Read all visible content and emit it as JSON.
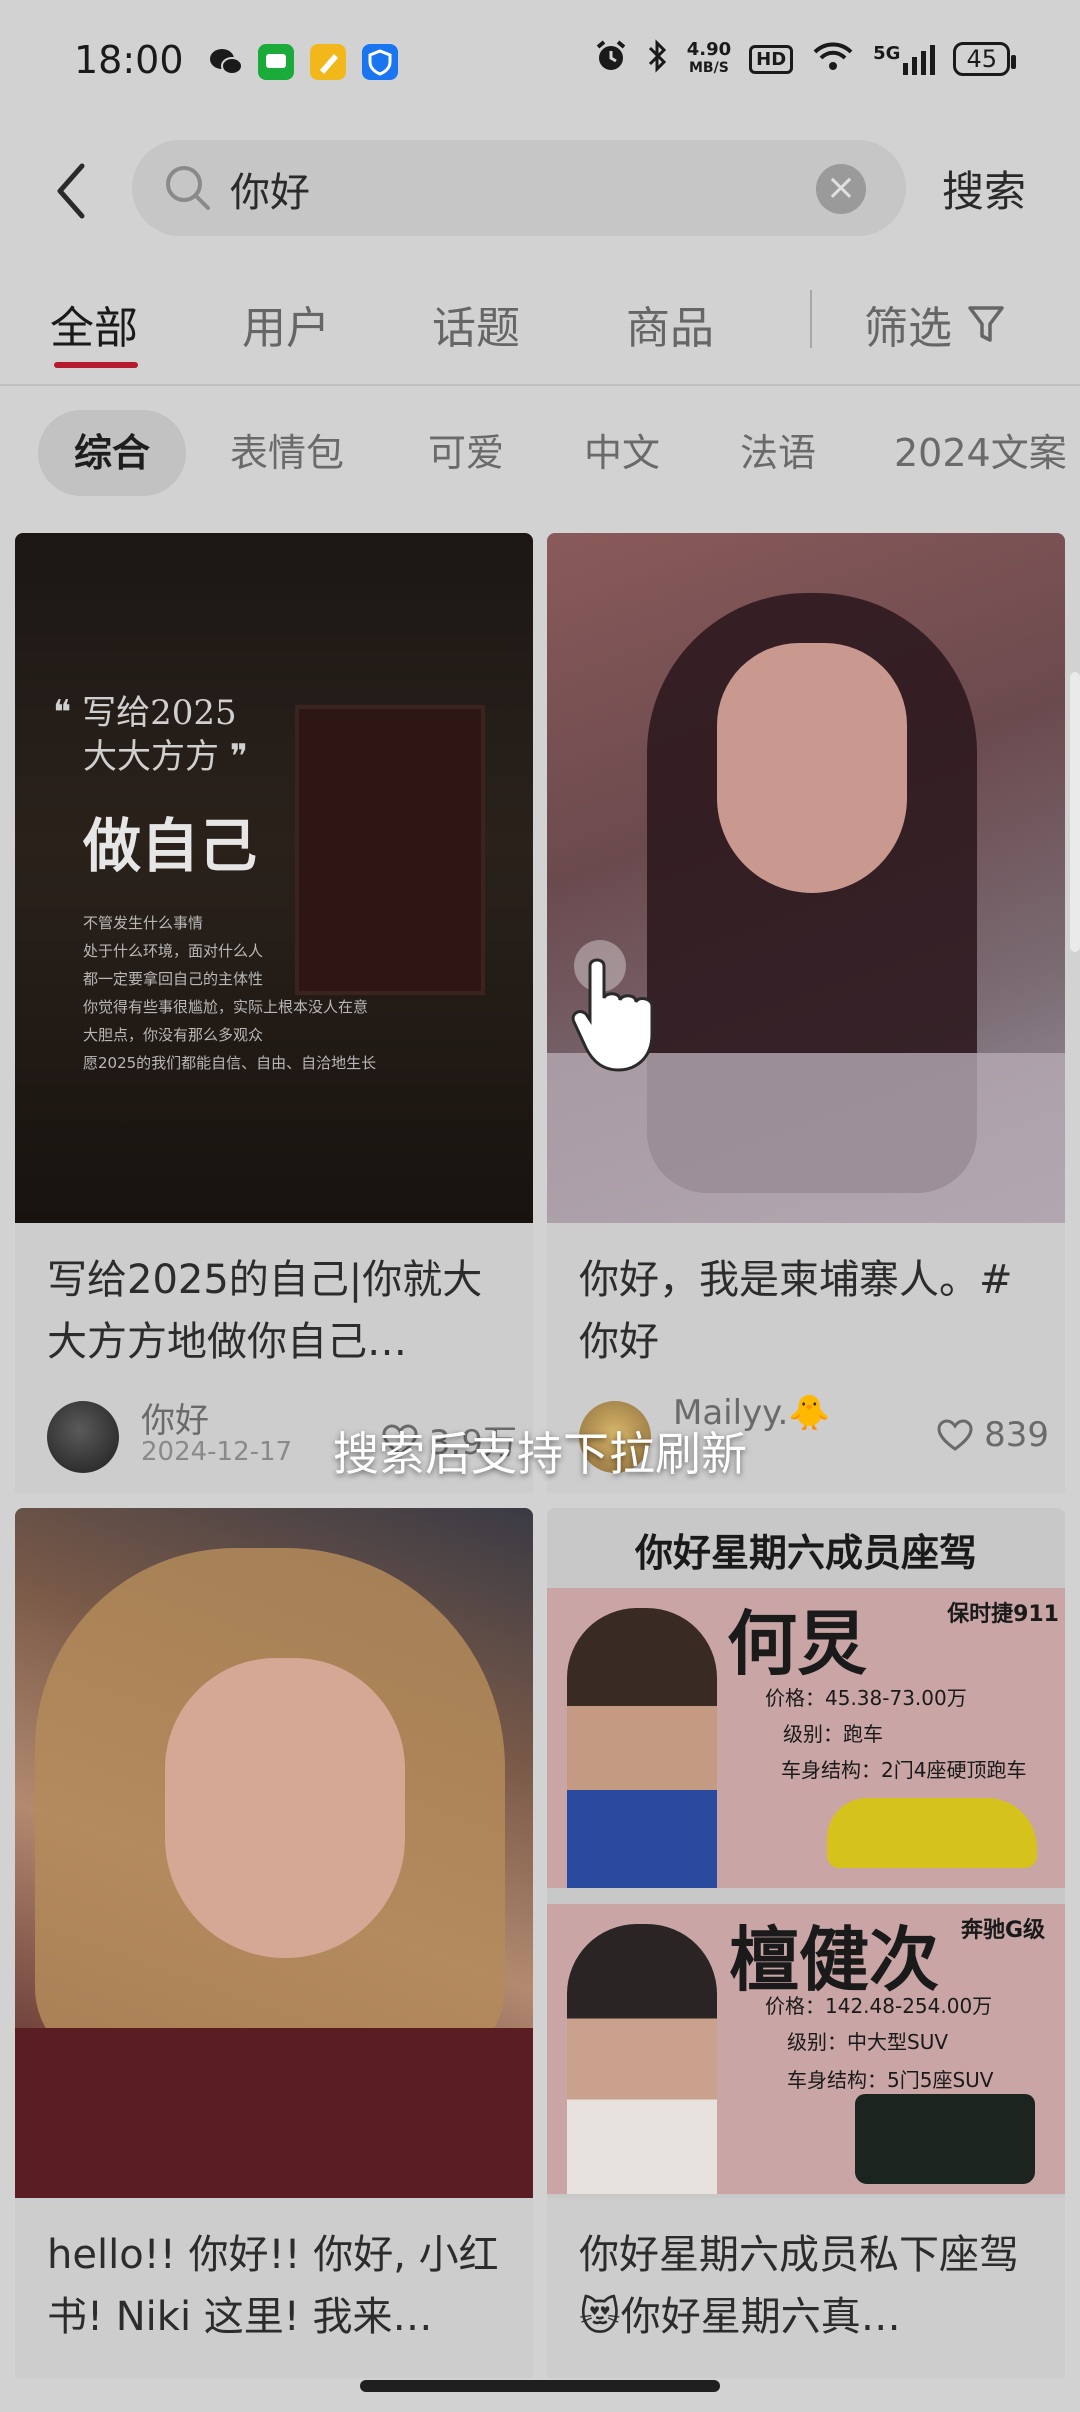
{
  "status_bar": {
    "time": "18:00",
    "net_speed_value": "4.90",
    "net_speed_unit": "MB/S",
    "hd": "HD",
    "signal_label": "5G",
    "battery": "45",
    "app_icons": [
      "wechat-icon",
      "messages-icon",
      "notes-icon",
      "security-icon"
    ]
  },
  "search": {
    "query": "你好",
    "submit_label": "搜索"
  },
  "tabs": {
    "items": [
      "全部",
      "用户",
      "话题",
      "商品"
    ],
    "active": "全部",
    "filter_label": "筛选"
  },
  "chips": {
    "items": [
      "综合",
      "表情包",
      "可爱",
      "中文",
      "法语",
      "2024文案"
    ],
    "active": "综合"
  },
  "posts": [
    {
      "title": "写给2025的自己|你就大大方方地做你自己…",
      "author": "你好",
      "date": "2024-12-17",
      "likes": "3.9万",
      "image": {
        "line1": "写给2025",
        "line2": "大大方方",
        "headline": "做自己",
        "lines": [
          "不管发生什么事情",
          "处于什么环境，面对什么人",
          "都一定要拿回自己的主体性",
          "你觉得有些事很尴尬，实际上根本没人在意",
          "大胆点，你没有那么多观众",
          "愿2025的我们都能自信、自由、自洽地生长"
        ]
      }
    },
    {
      "title": "你好，我是柬埔寨人。#你好",
      "author": "Mailyy.🐥",
      "likes": "839"
    },
    {
      "title": "hello!! 你好!! 你好, 小红书! Niki 这里! 我来…"
    },
    {
      "title": "你好星期六成员私下座驾 😻你好星期六真…",
      "image": {
        "header": "你好星期六成员座驾",
        "entries": [
          {
            "name": "何炅",
            "car": "保时捷911",
            "price": "价格：45.38-73.00万",
            "level": "级别：跑车",
            "body": "车身结构：2门4座硬顶跑车"
          },
          {
            "name": "檀健次",
            "car": "奔驰G级",
            "price": "价格：142.48-254.00万",
            "level": "级别：中大型SUV",
            "body": "车身结构：5门5座SUV"
          }
        ]
      }
    }
  ],
  "overlay": {
    "hint": "搜索后支持下拉刷新"
  }
}
